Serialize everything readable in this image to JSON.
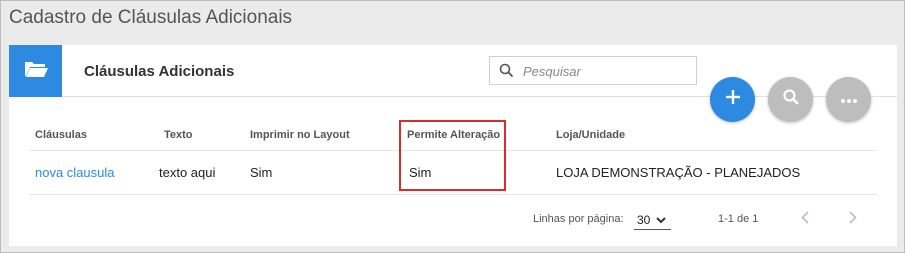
{
  "page": {
    "title": "Cadastro de Cláusulas Adicionais"
  },
  "card": {
    "title": "Cláusulas Adicionais",
    "search": {
      "placeholder": "Pesquisar",
      "value": ""
    }
  },
  "actions": {
    "add": "+",
    "more": "•••"
  },
  "table": {
    "columns": [
      "Cláusulas",
      "Texto",
      "Imprimir no Layout",
      "Permite Alteração",
      "Loja/Unidade"
    ],
    "rows": [
      [
        "nova clausula",
        "texto aqui",
        "Sim",
        "Sim",
        "LOJA DEMONSTRAÇÃO - PLANEJADOS"
      ]
    ]
  },
  "footer": {
    "rows_per_page_label": "Linhas por página:",
    "rows_per_page_value": "30",
    "range": "1-1 de 1"
  },
  "colors": {
    "accent": "#2d8ae0",
    "fab_gray": "#bdbdbd",
    "highlight_border": "#d32f2f"
  }
}
